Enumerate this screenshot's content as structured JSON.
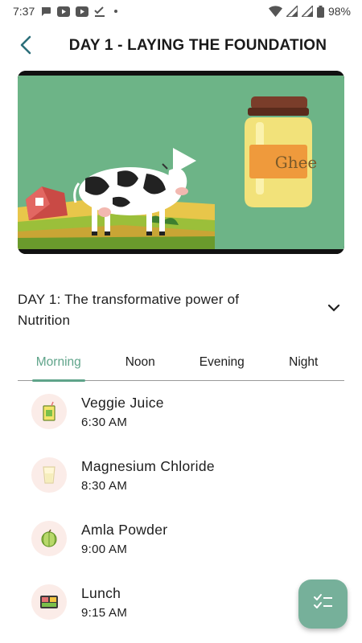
{
  "status_bar": {
    "time": "7:37",
    "battery": "98%",
    "left_icons": [
      "chat-bubble-icon",
      "youtube-icon",
      "youtube-icon",
      "check-download-icon",
      "dot-icon"
    ],
    "right_icons": [
      "wifi-icon",
      "signal-icon",
      "signal-icon",
      "battery-icon"
    ]
  },
  "header": {
    "title": "DAY 1 - LAYING THE FOUNDATION",
    "back_icon": "back-arrow-icon"
  },
  "video": {
    "jar_label": "Ghee",
    "play_icon": "play-icon"
  },
  "description": {
    "text": "DAY 1: The transformative power of Nutrition",
    "expand_icon": "chevron-down-icon"
  },
  "tabs": [
    {
      "label": "Morning",
      "active": true
    },
    {
      "label": "Noon",
      "active": false
    },
    {
      "label": "Evening",
      "active": false
    },
    {
      "label": "Night",
      "active": false
    }
  ],
  "items": [
    {
      "name": "Veggie Juice",
      "time": "6:30 AM",
      "icon": "juice-box-icon"
    },
    {
      "name": "Magnesium Chloride",
      "time": "8:30 AM",
      "icon": "glass-icon"
    },
    {
      "name": "Amla Powder",
      "time": "9:00 AM",
      "icon": "amla-fruit-icon"
    },
    {
      "name": "Lunch",
      "time": "9:15 AM",
      "icon": "lunch-tray-icon"
    }
  ],
  "fab": {
    "icon": "checklist-icon"
  },
  "colors": {
    "accent": "#5fa48a",
    "fab": "#76b09a",
    "icon_bg": "#fbece8",
    "video_bg": "#6db487"
  }
}
